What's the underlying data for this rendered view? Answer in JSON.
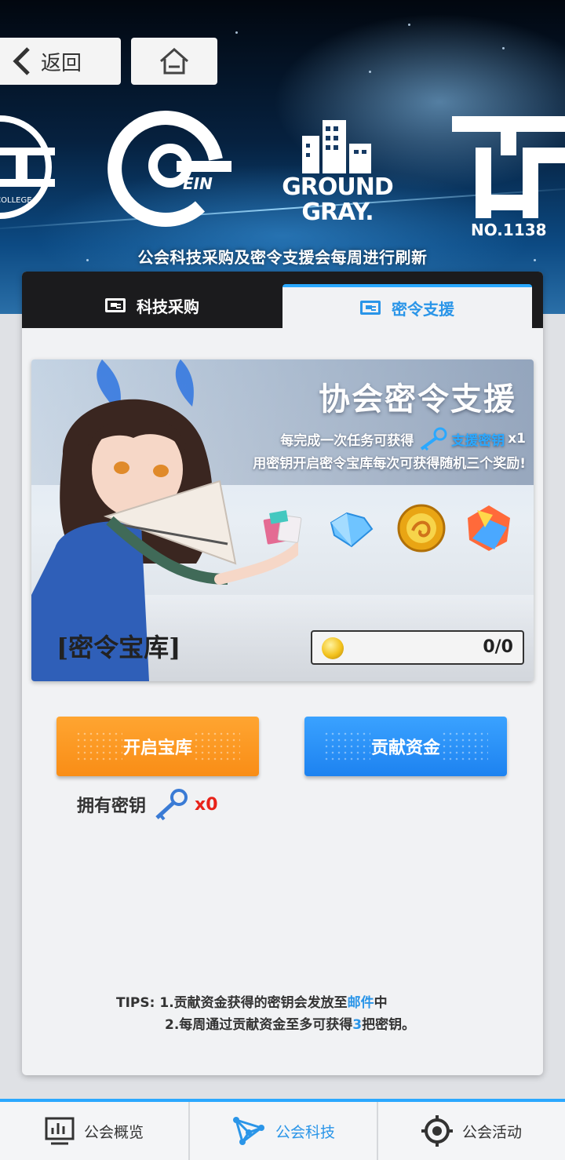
{
  "header": {
    "back_label": "返回",
    "subtitle": "公会科技采购及密令支援会每周进行刷新",
    "logos": {
      "cc_text": "C COLLEGE",
      "ein_text": "EIN",
      "gg_line1": "GROUND",
      "gg_line2": "GRAY.",
      "th_text": "NO.1138"
    }
  },
  "tabs": [
    {
      "label": "科技采购",
      "active": false
    },
    {
      "label": "密令支援",
      "active": true
    }
  ],
  "banner": {
    "title": "协会密令支援",
    "line1_prefix": "每完成一次任务可获得",
    "line1_item": "支援密钥",
    "line1_count": "x1",
    "line2": "用密钥开启密令宝库每次可获得随机三个奖励!",
    "vault_label": "[密令宝库]",
    "progress_value": "0/0",
    "rewards": [
      "cards-icon",
      "diamond-icon",
      "gold-orb-icon",
      "crystal-cube-icon"
    ]
  },
  "actions": {
    "open_vault": "开启宝库",
    "contribute": "贡献资金",
    "own_keys_label": "拥有密钥",
    "own_keys_count": "x0"
  },
  "tips": {
    "prefix": "TIPS:",
    "line1_a": "1.贡献资金获得的密钥会发放至",
    "line1_b": "邮件",
    "line1_c": "中",
    "line2_a": "2.每周通过贡献资金至多可获得",
    "line2_b": "3",
    "line2_c": "把密钥。"
  },
  "bottom_nav": [
    {
      "label": "公会概览",
      "icon": "chart-icon",
      "active": false
    },
    {
      "label": "公会科技",
      "icon": "network-icon",
      "active": true
    },
    {
      "label": "公会活动",
      "icon": "target-icon",
      "active": false
    }
  ],
  "colors": {
    "accent": "#2aa8ff",
    "orange_button": "#f98d16",
    "blue_button": "#1d82f0",
    "key_count": "#e8231a"
  }
}
